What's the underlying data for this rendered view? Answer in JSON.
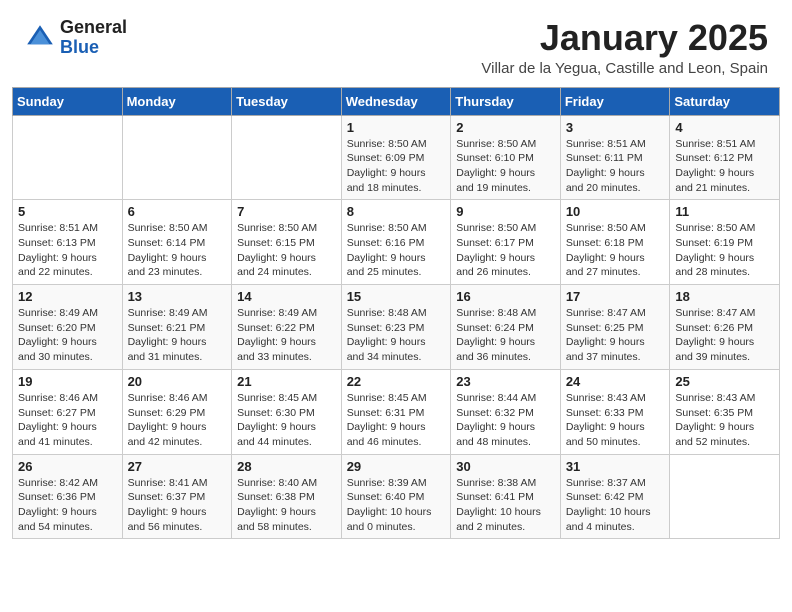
{
  "logo": {
    "general": "General",
    "blue": "Blue"
  },
  "header": {
    "month": "January 2025",
    "location": "Villar de la Yegua, Castille and Leon, Spain"
  },
  "days_of_week": [
    "Sunday",
    "Monday",
    "Tuesday",
    "Wednesday",
    "Thursday",
    "Friday",
    "Saturday"
  ],
  "weeks": [
    [
      {
        "day": "",
        "info": ""
      },
      {
        "day": "",
        "info": ""
      },
      {
        "day": "",
        "info": ""
      },
      {
        "day": "1",
        "info": "Sunrise: 8:50 AM\nSunset: 6:09 PM\nDaylight: 9 hours and 18 minutes."
      },
      {
        "day": "2",
        "info": "Sunrise: 8:50 AM\nSunset: 6:10 PM\nDaylight: 9 hours and 19 minutes."
      },
      {
        "day": "3",
        "info": "Sunrise: 8:51 AM\nSunset: 6:11 PM\nDaylight: 9 hours and 20 minutes."
      },
      {
        "day": "4",
        "info": "Sunrise: 8:51 AM\nSunset: 6:12 PM\nDaylight: 9 hours and 21 minutes."
      }
    ],
    [
      {
        "day": "5",
        "info": "Sunrise: 8:51 AM\nSunset: 6:13 PM\nDaylight: 9 hours and 22 minutes."
      },
      {
        "day": "6",
        "info": "Sunrise: 8:50 AM\nSunset: 6:14 PM\nDaylight: 9 hours and 23 minutes."
      },
      {
        "day": "7",
        "info": "Sunrise: 8:50 AM\nSunset: 6:15 PM\nDaylight: 9 hours and 24 minutes."
      },
      {
        "day": "8",
        "info": "Sunrise: 8:50 AM\nSunset: 6:16 PM\nDaylight: 9 hours and 25 minutes."
      },
      {
        "day": "9",
        "info": "Sunrise: 8:50 AM\nSunset: 6:17 PM\nDaylight: 9 hours and 26 minutes."
      },
      {
        "day": "10",
        "info": "Sunrise: 8:50 AM\nSunset: 6:18 PM\nDaylight: 9 hours and 27 minutes."
      },
      {
        "day": "11",
        "info": "Sunrise: 8:50 AM\nSunset: 6:19 PM\nDaylight: 9 hours and 28 minutes."
      }
    ],
    [
      {
        "day": "12",
        "info": "Sunrise: 8:49 AM\nSunset: 6:20 PM\nDaylight: 9 hours and 30 minutes."
      },
      {
        "day": "13",
        "info": "Sunrise: 8:49 AM\nSunset: 6:21 PM\nDaylight: 9 hours and 31 minutes."
      },
      {
        "day": "14",
        "info": "Sunrise: 8:49 AM\nSunset: 6:22 PM\nDaylight: 9 hours and 33 minutes."
      },
      {
        "day": "15",
        "info": "Sunrise: 8:48 AM\nSunset: 6:23 PM\nDaylight: 9 hours and 34 minutes."
      },
      {
        "day": "16",
        "info": "Sunrise: 8:48 AM\nSunset: 6:24 PM\nDaylight: 9 hours and 36 minutes."
      },
      {
        "day": "17",
        "info": "Sunrise: 8:47 AM\nSunset: 6:25 PM\nDaylight: 9 hours and 37 minutes."
      },
      {
        "day": "18",
        "info": "Sunrise: 8:47 AM\nSunset: 6:26 PM\nDaylight: 9 hours and 39 minutes."
      }
    ],
    [
      {
        "day": "19",
        "info": "Sunrise: 8:46 AM\nSunset: 6:27 PM\nDaylight: 9 hours and 41 minutes."
      },
      {
        "day": "20",
        "info": "Sunrise: 8:46 AM\nSunset: 6:29 PM\nDaylight: 9 hours and 42 minutes."
      },
      {
        "day": "21",
        "info": "Sunrise: 8:45 AM\nSunset: 6:30 PM\nDaylight: 9 hours and 44 minutes."
      },
      {
        "day": "22",
        "info": "Sunrise: 8:45 AM\nSunset: 6:31 PM\nDaylight: 9 hours and 46 minutes."
      },
      {
        "day": "23",
        "info": "Sunrise: 8:44 AM\nSunset: 6:32 PM\nDaylight: 9 hours and 48 minutes."
      },
      {
        "day": "24",
        "info": "Sunrise: 8:43 AM\nSunset: 6:33 PM\nDaylight: 9 hours and 50 minutes."
      },
      {
        "day": "25",
        "info": "Sunrise: 8:43 AM\nSunset: 6:35 PM\nDaylight: 9 hours and 52 minutes."
      }
    ],
    [
      {
        "day": "26",
        "info": "Sunrise: 8:42 AM\nSunset: 6:36 PM\nDaylight: 9 hours and 54 minutes."
      },
      {
        "day": "27",
        "info": "Sunrise: 8:41 AM\nSunset: 6:37 PM\nDaylight: 9 hours and 56 minutes."
      },
      {
        "day": "28",
        "info": "Sunrise: 8:40 AM\nSunset: 6:38 PM\nDaylight: 9 hours and 58 minutes."
      },
      {
        "day": "29",
        "info": "Sunrise: 8:39 AM\nSunset: 6:40 PM\nDaylight: 10 hours and 0 minutes."
      },
      {
        "day": "30",
        "info": "Sunrise: 8:38 AM\nSunset: 6:41 PM\nDaylight: 10 hours and 2 minutes."
      },
      {
        "day": "31",
        "info": "Sunrise: 8:37 AM\nSunset: 6:42 PM\nDaylight: 10 hours and 4 minutes."
      },
      {
        "day": "",
        "info": ""
      }
    ]
  ]
}
